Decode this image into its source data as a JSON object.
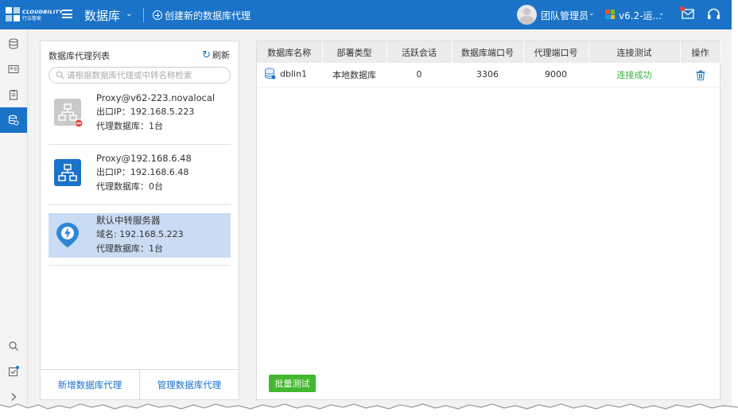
{
  "topbar": {
    "logo_text": "CLOUDBILITY",
    "logo_sub": "行云管家",
    "title": "数据库",
    "create_label": "创建新的数据库代理",
    "user_name": "团队管理员",
    "version": "v6.2-运..."
  },
  "left_panel": {
    "title": "数据库代理列表",
    "refresh_label": "刷新",
    "search_placeholder": "请根据数据库代理或中转名称检索",
    "proxies": [
      {
        "name": "Proxy@v62-223.novalocal",
        "line2": "出口IP：192.168.5.223",
        "line3": "代理数据库：1台",
        "status": "offline"
      },
      {
        "name": "Proxy@192.168.6.48",
        "line2": "出口IP：192.168.6.48",
        "line3": "代理数据库：0台",
        "status": "online"
      },
      {
        "name": "默认中转服务器",
        "line2": "域名: 192.168.5.223",
        "line3": "代理数据库：1台",
        "status": "relay"
      }
    ],
    "footer": {
      "add_label": "新增数据库代理",
      "manage_label": "管理数据库代理"
    }
  },
  "table": {
    "headers": [
      "数据库名称",
      "部署类型",
      "活跃会话",
      "数据库端口号",
      "代理端口号",
      "连接测试",
      "操作"
    ],
    "rows": [
      {
        "name": "dblin1",
        "deploy": "本地数据库",
        "sessions": "0",
        "db_port": "3306",
        "proxy_port": "9000",
        "test": "连接成功"
      }
    ]
  },
  "batch_test_label": "批量测试",
  "colors": {
    "accent": "#1a73c8",
    "success": "#36b03b",
    "batch_button": "#43b72f",
    "selected_row": "#c9dcf3"
  },
  "icons": {
    "rail": [
      "database-icon",
      "id-card-icon",
      "clipboard-icon",
      "database-proxy-icon",
      "search-icon",
      "task-check-icon",
      "expand-icon"
    ]
  }
}
